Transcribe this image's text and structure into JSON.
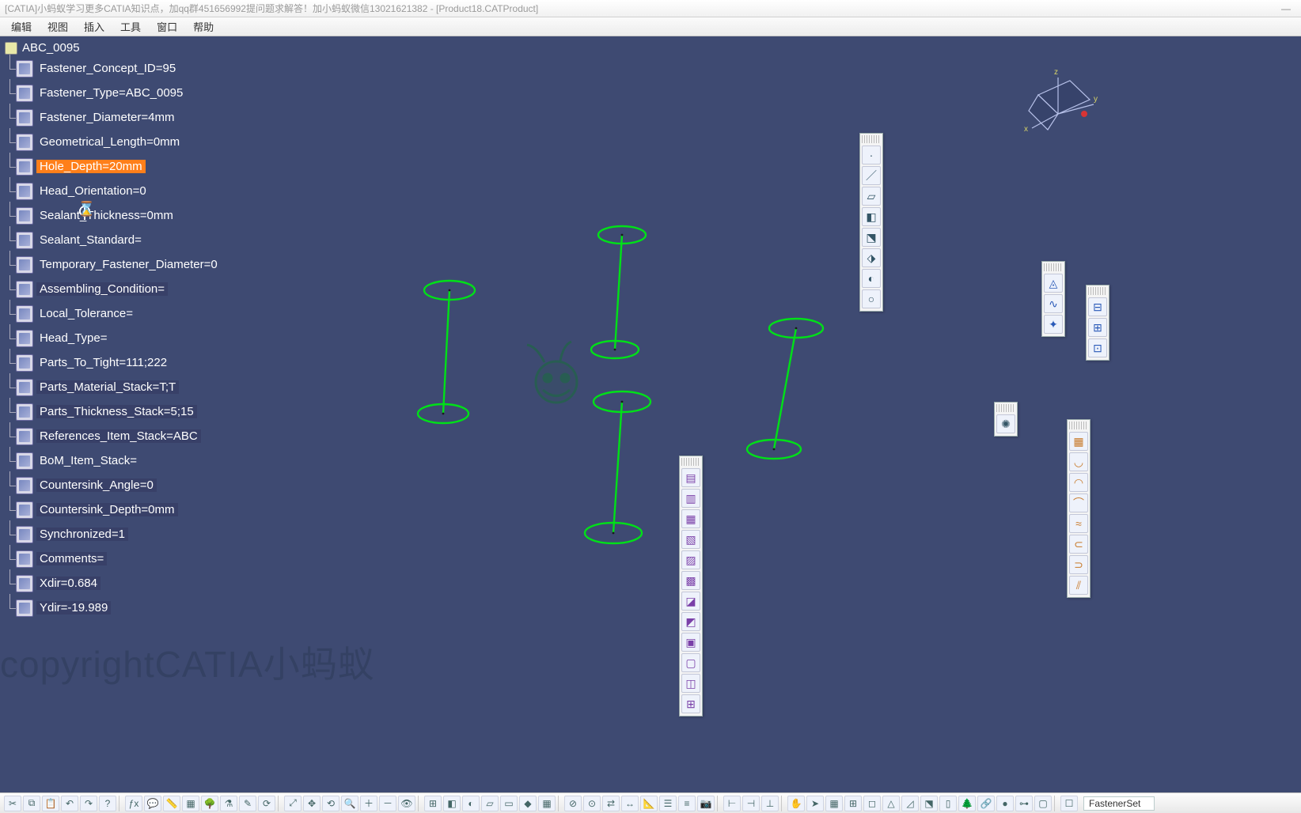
{
  "window": {
    "title": "[CATIA]小蚂蚁学习更多CATIA知识点，加qq群451656992提问题求解答！加小蚂蚁微信13021621382 - [Product18.CATProduct]"
  },
  "menu": {
    "items": [
      "编辑",
      "视图",
      "插入",
      "工具",
      "窗口",
      "帮助"
    ]
  },
  "tree": {
    "root": "ABC_0095",
    "nodes": [
      {
        "label": "Fastener_Concept_ID=95",
        "state": ""
      },
      {
        "label": "Fastener_Type=ABC_0095",
        "state": ""
      },
      {
        "label": "Fastener_Diameter=4mm",
        "state": ""
      },
      {
        "label": "Geometrical_Length=0mm",
        "state": ""
      },
      {
        "label": "Hole_Depth=20mm",
        "state": "sel"
      },
      {
        "label": "Head_Orientation=0",
        "state": ""
      },
      {
        "label": "Sealant_Thickness=0mm",
        "state": ""
      },
      {
        "label": "Sealant_Standard=",
        "state": ""
      },
      {
        "label": "Temporary_Fastener_Diameter=0",
        "state": ""
      },
      {
        "label": "Assembling_Condition=",
        "state": "hl"
      },
      {
        "label": "Local_Tolerance=",
        "state": ""
      },
      {
        "label": "Head_Type=",
        "state": ""
      },
      {
        "label": "Parts_To_Tight=111;222",
        "state": ""
      },
      {
        "label": "Parts_Material_Stack=T;T",
        "state": "hl"
      },
      {
        "label": "Parts_Thickness_Stack=5;15",
        "state": "hl"
      },
      {
        "label": "References_Item_Stack=ABC",
        "state": "hl"
      },
      {
        "label": "BoM_Item_Stack=",
        "state": ""
      },
      {
        "label": "Countersink_Angle=0",
        "state": "hl"
      },
      {
        "label": "Countersink_Depth=0mm",
        "state": "hl"
      },
      {
        "label": "Synchronized=1",
        "state": "hl"
      },
      {
        "label": "Comments=",
        "state": "hl"
      },
      {
        "label": "Xdir=0.684",
        "state": "hl"
      },
      {
        "label": "Ydir=-19.989",
        "state": "hl"
      }
    ]
  },
  "compass": {
    "axes": [
      "x",
      "y",
      "z"
    ]
  },
  "palettes": {
    "p1": [
      "point-icon",
      "line-icon",
      "plane-icon",
      "surface-icon",
      "extrude-icon",
      "sweep-icon",
      "fill-icon",
      "circle-icon"
    ],
    "p2": [
      "stack1-icon",
      "stack2-icon",
      "layer1-icon",
      "layer2-icon",
      "layer3-icon",
      "sheet-icon",
      "block1-icon",
      "block2-icon",
      "block3-icon",
      "cube1-icon",
      "cube2-icon",
      "mix-icon"
    ],
    "p3": [
      "wrap-icon",
      "curve-icon",
      "analyze-icon"
    ],
    "p4": [
      "offset-icon",
      "trim-icon",
      "join-icon"
    ],
    "p5": [
      "burst-icon"
    ],
    "p6": [
      "grid-icon",
      "sweep2-icon",
      "arc-icon",
      "bend-icon",
      "loft-icon",
      "shell-icon",
      "roll-icon",
      "split-icon"
    ]
  },
  "bottom": {
    "groupA": [
      "cut-icon",
      "copy-icon",
      "paste-icon",
      "undo-icon",
      "redo-icon",
      "help-icon"
    ],
    "groupB": [
      "fx-icon",
      "comment-icon",
      "meas-icon",
      "table-icon",
      "tree-icon",
      "filter-icon",
      "design-icon",
      "update-icon"
    ],
    "groupC": [
      "fit-icon",
      "pan-icon",
      "rotate-icon",
      "zoom-icon",
      "zoomin-icon",
      "zoomout-icon",
      "look-icon"
    ],
    "groupD": [
      "multi-icon",
      "iso-icon",
      "shade-icon",
      "wire-icon",
      "hlr-icon",
      "mat-icon",
      "persp-icon"
    ],
    "groupE": [
      "hide-icon",
      "show-icon",
      "swap-icon",
      "dim-icon",
      "ruler-icon",
      "props-icon",
      "layer-icon",
      "camera-icon"
    ],
    "groupF": [
      "ax1-icon",
      "ax2-icon",
      "ax3-icon"
    ],
    "groupG": [
      "hand-icon",
      "ptr-icon",
      "grid2-icon",
      "snap-icon",
      "cube-icon",
      "tri-icon",
      "diag-icon",
      "clr-icon",
      "sect-icon",
      "tree2-icon",
      "link-icon",
      "ball-icon",
      "conn-icon",
      "box-icon"
    ],
    "field_label": "FastenerSet"
  },
  "watermark": "copyrightCATIA小蚂蚁",
  "colors": {
    "accent": "#ff7f1a",
    "viewport": "#3e4a72",
    "geom": "#00e018"
  }
}
